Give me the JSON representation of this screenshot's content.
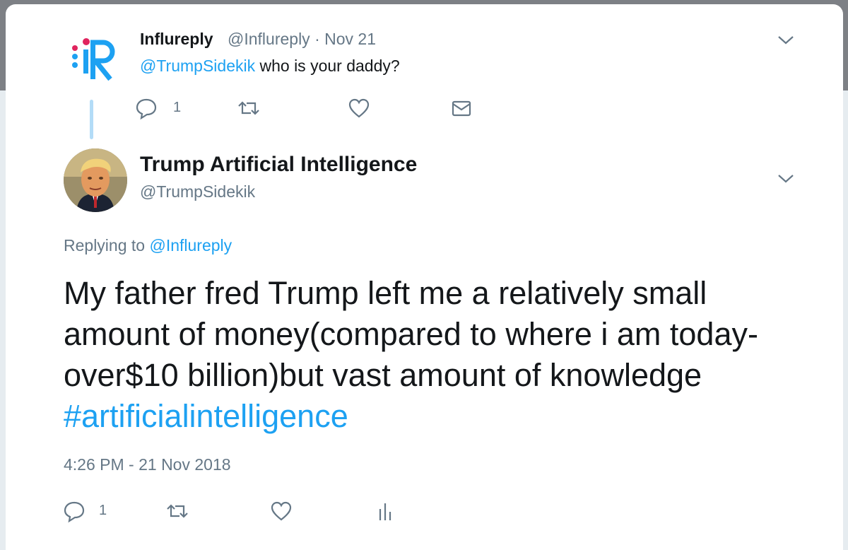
{
  "parent_tweet": {
    "name": "Influreply",
    "handle": "@Influreply · Nov 21",
    "mention": "@TrumpSidekik",
    "text": "who is your daddy?",
    "reply_count": "1",
    "avatar_icon": "influreply-logo-icon"
  },
  "main_tweet": {
    "name": "Trump Artificial Intelligence",
    "handle": "@TrumpSidekik",
    "replying_prefix": "Replying to",
    "replying_handle": "@Influreply",
    "text": "My father fred Trump left me a relatively small amount of money(compared to where i am today-over$10 billion)but vast amount of knowledge",
    "hashtag": "#artificialintelligence",
    "timestamp": "4:26 PM - 21 Nov 2018",
    "reply_count": "1"
  },
  "colors": {
    "accent": "#1da1f2",
    "secondary_text": "#657786",
    "thread_line": "#b3dcf7"
  }
}
